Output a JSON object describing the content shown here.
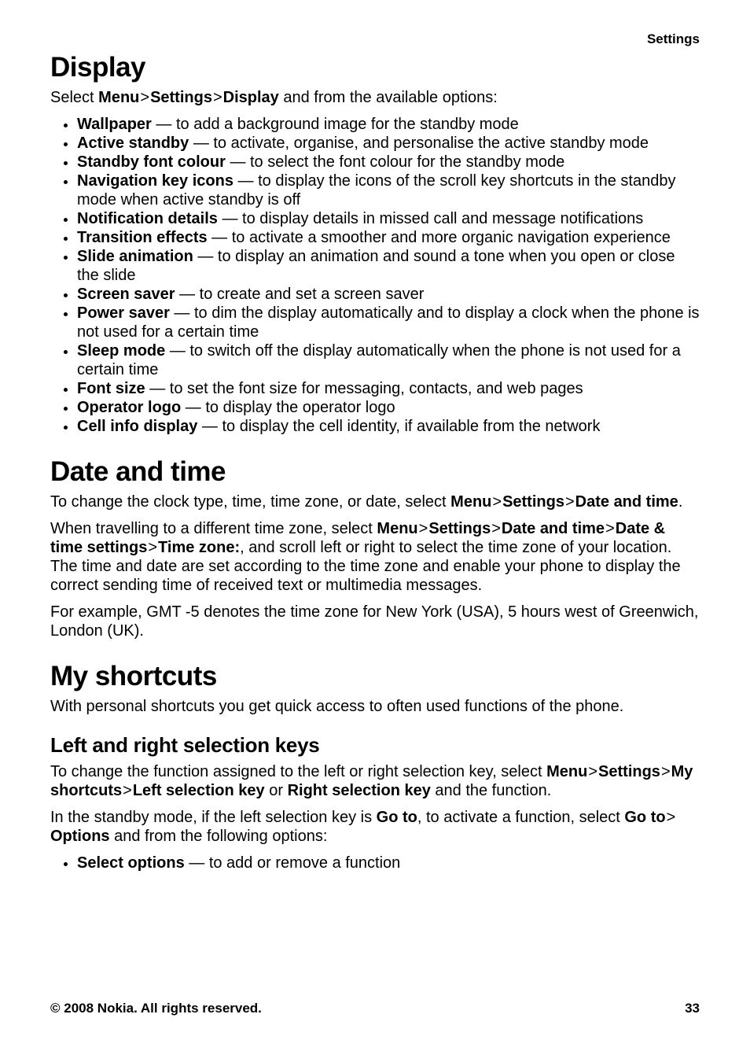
{
  "header": {
    "section_label": "Settings"
  },
  "display": {
    "title": "Display",
    "intro_prefix": "Select ",
    "intro_b1": "Menu",
    "intro_sep": " > ",
    "intro_b2": "Settings",
    "intro_b3": "Display",
    "intro_suffix": " and from the available options:",
    "items": [
      {
        "term": "Wallpaper",
        "desc": " — to add a background image for the standby mode"
      },
      {
        "term": "Active standby",
        "desc": " — to activate, organise, and personalise the active standby mode"
      },
      {
        "term": "Standby font colour",
        "desc": " — to select the font colour for the standby mode"
      },
      {
        "term": "Navigation key icons",
        "desc": " — to display the icons of the scroll key shortcuts in the standby mode when active standby is off"
      },
      {
        "term": "Notification details",
        "desc": " — to display details in missed call and message notifications"
      },
      {
        "term": "Transition effects",
        "desc": " — to activate a smoother and more organic navigation experience"
      },
      {
        "term": "Slide animation",
        "desc": " — to display an animation and sound a tone when you open or close the slide"
      },
      {
        "term": "Screen saver",
        "desc": " — to create and set a screen saver"
      },
      {
        "term": "Power saver",
        "desc": " — to dim the display automatically and to display a clock when the phone is not used for a certain time"
      },
      {
        "term": "Sleep mode",
        "desc": " — to switch off the display automatically when the phone is not used for a certain time"
      },
      {
        "term": "Font size",
        "desc": " — to set the font size for messaging, contacts, and web pages"
      },
      {
        "term": "Operator logo",
        "desc": " — to display the operator logo"
      },
      {
        "term": "Cell info display",
        "desc": " — to display the cell identity, if available from the network"
      }
    ]
  },
  "datetime": {
    "title": "Date and time",
    "p1_prefix": "To change the clock type, time, time zone, or date, select ",
    "p1_b1": "Menu",
    "p1_sep": " > ",
    "p1_b2": "Settings",
    "p1_b3": "Date and time",
    "p1_suffix": ".",
    "p2_prefix": "When travelling to a different time zone, select ",
    "p2_b1": "Menu",
    "p2_b2": "Settings",
    "p2_b3": "Date and time",
    "p2_b4": "Date & time settings",
    "p2_b5": "Time zone:",
    "p2_suffix": ", and scroll left or right to select the time zone of your location. The time and date are set according to the time zone and enable your phone to display the correct sending time of received text or multimedia messages.",
    "p3": "For example, GMT -5 denotes the time zone for New York (USA), 5 hours west of Greenwich, London (UK)."
  },
  "shortcuts": {
    "title": "My shortcuts",
    "intro": "With personal shortcuts you get quick access to often used functions of the phone.",
    "sub": {
      "title": "Left and right selection keys",
      "p1_prefix": "To change the function assigned to the left or right selection key, select ",
      "p1_b1": "Menu",
      "p1_sep": " > ",
      "p1_b2": "Settings",
      "p1_b3": "My shortcuts",
      "p1_b4": "Left selection key",
      "p1_or": " or ",
      "p1_b5": "Right selection key",
      "p1_suffix": " and the function.",
      "p2_prefix": "In the standby mode, if the left selection key is ",
      "p2_b1": "Go to",
      "p2_mid": ", to activate a function, select ",
      "p2_b2": "Go to",
      "p2_sep": " > ",
      "p2_b3": "Options",
      "p2_suffix": " and from the following options:",
      "items": [
        {
          "term": "Select options",
          "desc": " — to add or remove a function"
        }
      ]
    }
  },
  "footer": {
    "copyright": "© 2008 Nokia. All rights reserved.",
    "page_number": "33"
  }
}
